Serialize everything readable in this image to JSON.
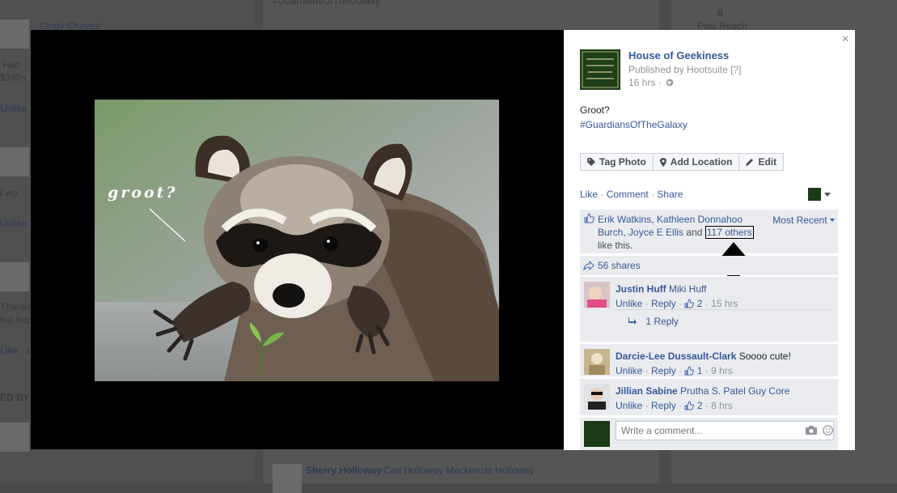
{
  "background": {
    "name1": "Cindy Chavez",
    "snippet1": "Had",
    "snippet2": "$340+",
    "unlike1": "Unlike",
    "snippet3": "I wo",
    "unlike2": "Unlike",
    "snippet4": "Thanks",
    "snippet5": "hat hap",
    "snippet6": "Like · C",
    "snippet7": "ED BY",
    "hashtag_top": "#GuardiansOfTheGalaxy",
    "post_reach_count": "0",
    "post_reach_label": "Post Reach",
    "bottom_name": "Sherry Holloway",
    "bottom_others": "Carl Holloway Mackenzie Holloway"
  },
  "photo": {
    "caption": "groot?"
  },
  "panel": {
    "close": "×",
    "page_name": "House of Geekiness",
    "published_by": "Published by Hootsuite [?]",
    "time": "16 hrs ·",
    "post_line1": "Groot?",
    "post_hashtag": "#GuardiansOfTheGalaxy",
    "buttons": {
      "tag": "Tag Photo",
      "location": "Add Location",
      "edit": "Edit"
    },
    "actions": {
      "like": "Like",
      "comment": "Comment",
      "share": "Share",
      "sep": "·"
    },
    "likes": {
      "names": "Erik Watkins, Kathleen Donnahoo Burch, Joyce E Ellis",
      "and": "and",
      "others": "117 others",
      "suffix": "like this.",
      "sort": "Most Recent"
    },
    "shares": "56 shares",
    "comments": [
      {
        "name": "Justin Huff",
        "text": "Miki Huff",
        "unlike": "Unlike",
        "reply": "Reply",
        "likes": "2",
        "time": "15 hrs",
        "replies": "1 Reply"
      },
      {
        "name": "Darcie-Lee Dussault-Clark",
        "text": "Soooo cute!",
        "unlike": "Unlike",
        "reply": "Reply",
        "likes": "1",
        "time": "9 hrs"
      },
      {
        "name": "Jillian Sabine",
        "text": "Prutha S. Patel Guy Core",
        "unlike": "Unlike",
        "reply": "Reply",
        "likes": "2",
        "time": "8 hrs"
      }
    ],
    "write_placeholder": "Write a comment..."
  },
  "colors": {
    "link": "#365899",
    "muted": "#90949c",
    "panel_bg": "#e9ebee"
  }
}
